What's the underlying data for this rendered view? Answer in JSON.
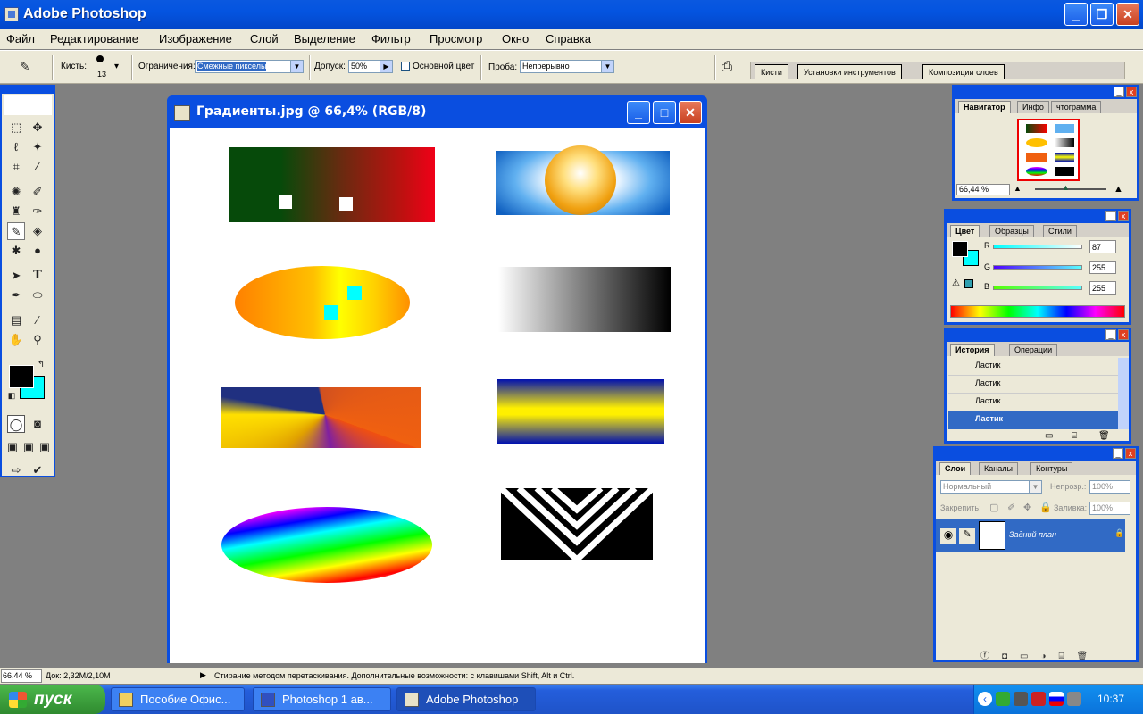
{
  "app": {
    "title": "Adobe Photoshop"
  },
  "menu": [
    "Файл",
    "Редактирование",
    "Изображение",
    "Слой",
    "Выделение",
    "Фильтр",
    "Просмотр",
    "Окно",
    "Справка"
  ],
  "options": {
    "brush_label": "Кисть:",
    "brush_size": "13",
    "limits_label": "Ограничения:",
    "limits_value": "Смежные пикселы",
    "tolerance_label": "Допуск:",
    "tolerance_value": "50%",
    "primary_color_label": "Основной цвет",
    "sample_label": "Проба:",
    "sample_value": "Непрерывно"
  },
  "palette_well": [
    "Кисти",
    "Установки инструментов",
    "Композиции слоев"
  ],
  "document": {
    "title": "Градиенты.jpg @ 66,4% (RGB/8)"
  },
  "navigator": {
    "tabs": [
      "Навигатор",
      "Инфо",
      "Гистограмма"
    ],
    "tab3_visible": "чтограмма",
    "zoom": "66,44 %"
  },
  "color_panel": {
    "tabs": [
      "Цвет",
      "Образцы",
      "Стили"
    ],
    "r_label": "R",
    "r_value": "87",
    "g_label": "G",
    "g_value": "255",
    "b_label": "B",
    "b_value": "255",
    "fg_color": "#000000",
    "bg_color": "#00ffff"
  },
  "history": {
    "tabs": [
      "История",
      "Операции"
    ],
    "items": [
      "Ластик",
      "Ластик",
      "Ластик",
      "Ластик"
    ]
  },
  "layers": {
    "tabs": [
      "Слои",
      "Каналы",
      "Контуры"
    ],
    "blend_mode": "Нормальный",
    "opacity_label": "Непрозр.:",
    "opacity_value": "100%",
    "lock_label": "Закрепить:",
    "fill_label": "Заливка:",
    "fill_value": "100%",
    "layer_name": "Задний план"
  },
  "status": {
    "zoom": "66,44 %",
    "doc": "Док: 2,32M/2,10M",
    "message": "Стирание методом перетаскивания. Дополнительные возможности: с клавишами Shift, Alt и Ctrl."
  },
  "taskbar": {
    "start": "пуск",
    "tasks": [
      "Пособие Офис...",
      "Photoshop 1 ав...",
      "Adobe Photoshop"
    ],
    "clock": "10:37"
  }
}
